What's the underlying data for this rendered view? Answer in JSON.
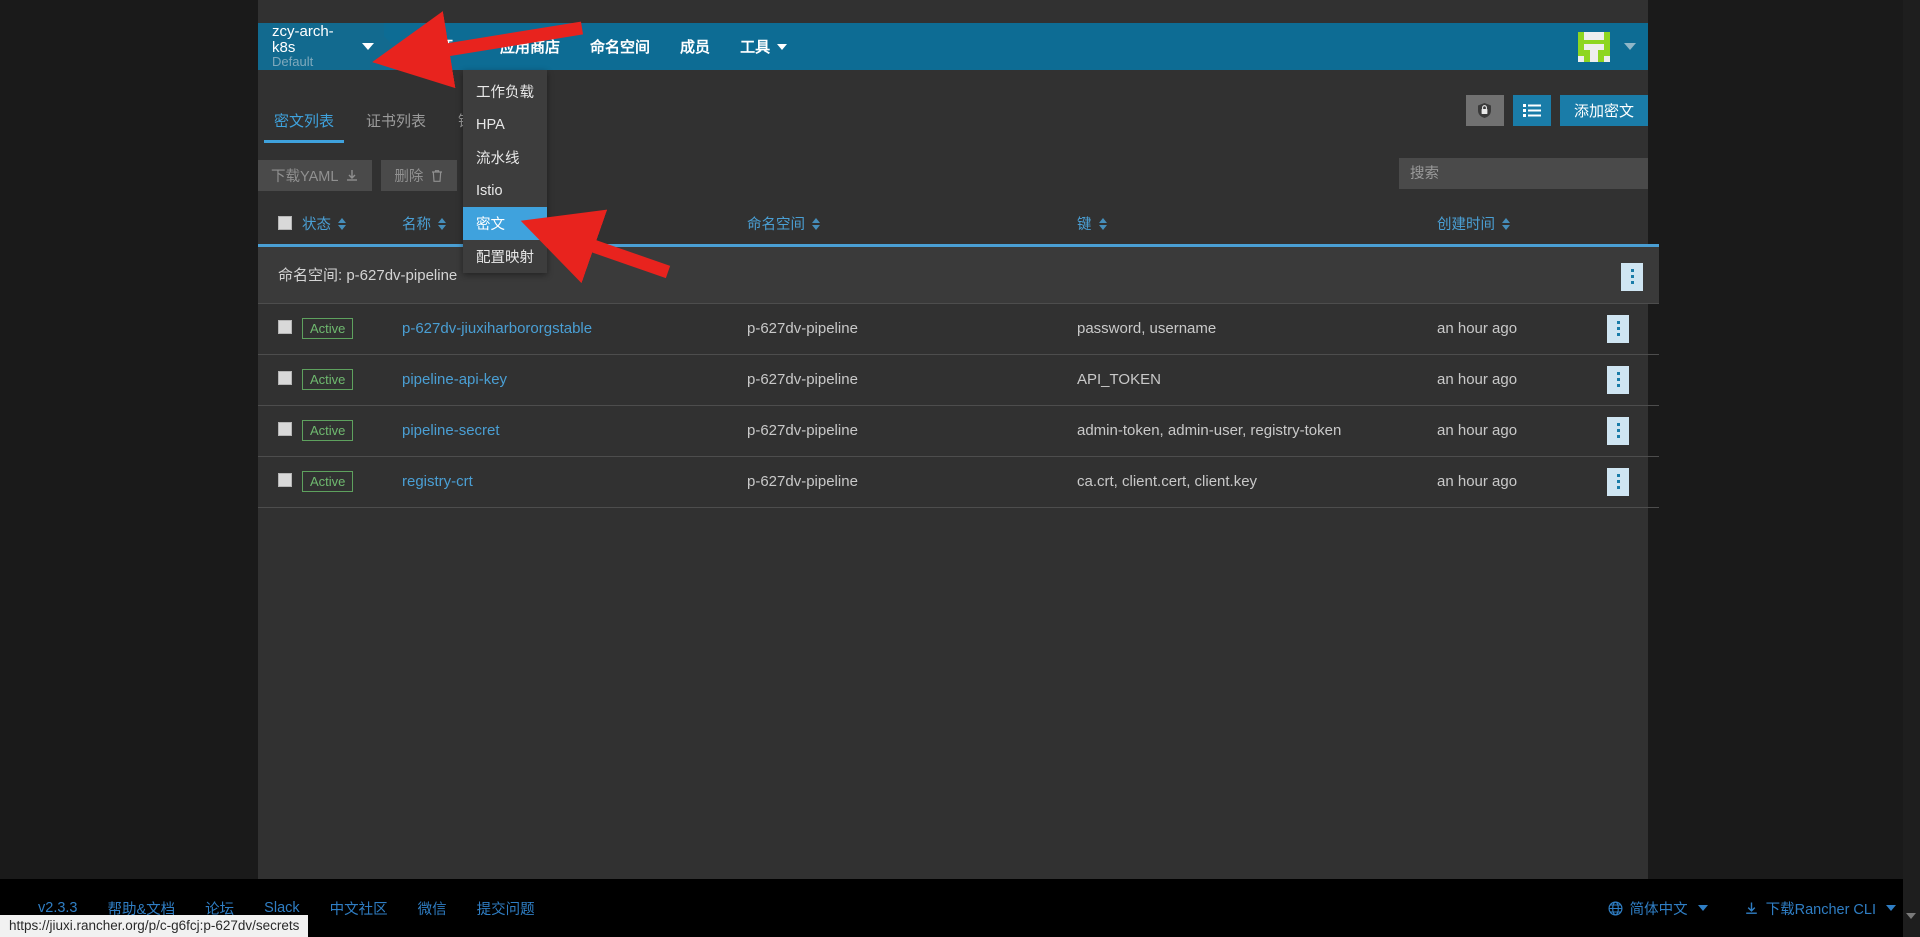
{
  "header": {
    "logo_icon": "rancher-cow-logo",
    "cluster": {
      "name": "zcy-arch-k8s",
      "project": "Default"
    },
    "nav": [
      {
        "label": "资源",
        "has_caret": true
      },
      {
        "label": "应用商店",
        "has_caret": false
      },
      {
        "label": "命名空间",
        "has_caret": false
      },
      {
        "label": "成员",
        "has_caret": false
      },
      {
        "label": "工具",
        "has_caret": true
      }
    ],
    "avatar_icon": "user-avatar-icon",
    "avatar_caret_icon": "chevron-down-icon"
  },
  "dropdown": {
    "items": [
      {
        "label": "工作负载",
        "active": false
      },
      {
        "label": "HPA",
        "active": false
      },
      {
        "label": "流水线",
        "active": false
      },
      {
        "label": "Istio",
        "active": false
      },
      {
        "label": "密文",
        "active": true
      },
      {
        "label": "配置映射",
        "active": false
      }
    ]
  },
  "tabs": [
    {
      "label": "密文列表",
      "active": true
    },
    {
      "label": "证书列表",
      "active": false
    },
    {
      "label": "镜像库凭证",
      "active": false
    }
  ],
  "toolbar": {
    "secure_icon": "lock-shield-icon",
    "list_icon": "list-view-icon",
    "add_label": "添加密文"
  },
  "actions": {
    "download_label": "下载YAML",
    "download_icon": "download-icon",
    "delete_label": "删除",
    "delete_icon": "trash-icon",
    "search_placeholder": "搜索"
  },
  "table": {
    "columns": [
      {
        "key": "status",
        "label": "状态",
        "sortable": true
      },
      {
        "key": "name",
        "label": "名称",
        "sortable": true
      },
      {
        "key": "ns",
        "label": "命名空间",
        "sortable": true
      },
      {
        "key": "keys",
        "label": "键",
        "sortable": true
      },
      {
        "key": "created",
        "label": "创建时间",
        "sortable": true
      }
    ],
    "group_label_prefix": "命名空间:",
    "group_label_value": "p-627dv-pipeline",
    "rows": [
      {
        "state": "Active",
        "name": "p-627dv-jiuxiharbororgstable",
        "ns": "p-627dv-pipeline",
        "keys": "password, username",
        "created": "an hour ago"
      },
      {
        "state": "Active",
        "name": "pipeline-api-key",
        "ns": "p-627dv-pipeline",
        "keys": "API_TOKEN",
        "created": "an hour ago"
      },
      {
        "state": "Active",
        "name": "pipeline-secret",
        "ns": "p-627dv-pipeline",
        "keys": "admin-token, admin-user, registry-token",
        "created": "an hour ago"
      },
      {
        "state": "Active",
        "name": "registry-crt",
        "ns": "p-627dv-pipeline",
        "keys": "ca.crt, client.cert, client.key",
        "created": "an hour ago"
      }
    ]
  },
  "footer": {
    "links": [
      {
        "label": "v2.3.3"
      },
      {
        "label": "帮助&文档"
      },
      {
        "label": "论坛"
      },
      {
        "label": "Slack"
      },
      {
        "label": "中文社区"
      },
      {
        "label": "微信"
      },
      {
        "label": "提交问题"
      }
    ],
    "language": {
      "label": "简体中文",
      "icon": "globe-icon"
    },
    "cli": {
      "label": "下载Rancher CLI",
      "icon": "download-icon"
    }
  },
  "statusbar": {
    "url": "https://jiuxi.rancher.org/p/c-g6fcj:p-627dv/secrets"
  },
  "colors": {
    "header_blue": "#0d6c94",
    "accent_blue": "#3fa2dd",
    "link_blue": "#4a9fd4",
    "active_green": "#6fb96f",
    "panel_bg": "#313131",
    "annotation_red": "#e8231e"
  }
}
